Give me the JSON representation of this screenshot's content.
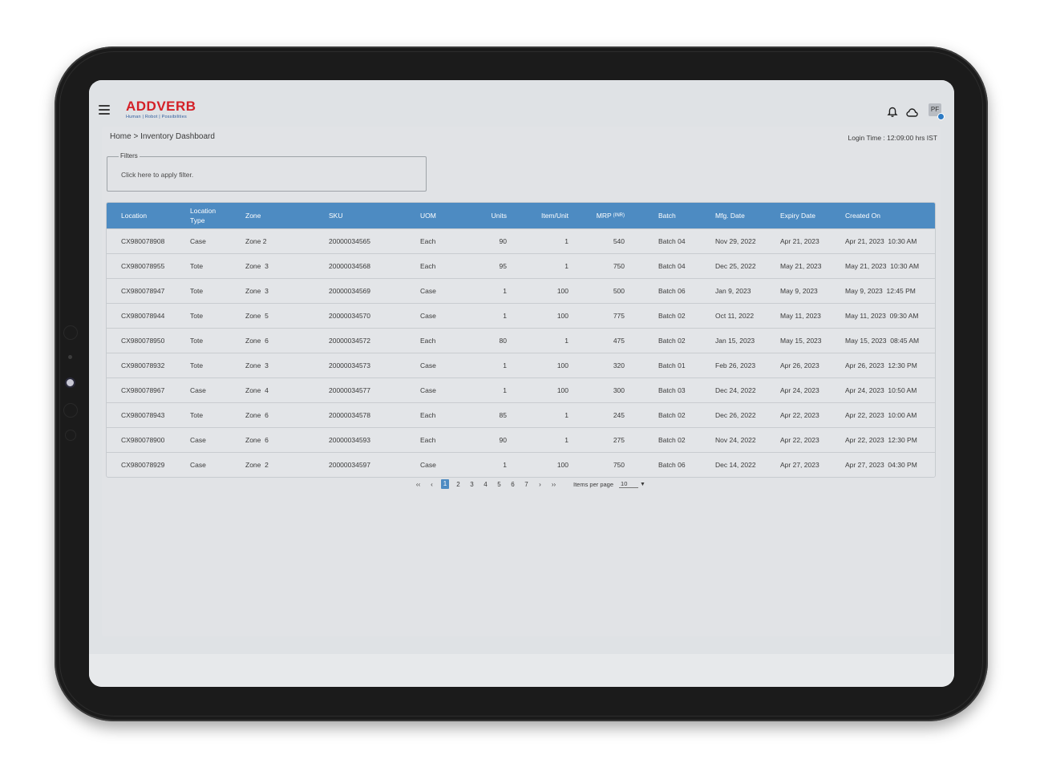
{
  "app": {
    "brand_name": "ADDVERB",
    "brand_tagline": "Human | Robot | Possibilities",
    "avatar_initials": "PF",
    "brand_color": "#d42027",
    "accent_color": "#4d8bc2"
  },
  "breadcrumb": "Home > Inventory Dashboard",
  "login_time": "Login Time : 12:09:00 hrs IST",
  "filters": {
    "legend": "Filters",
    "placeholder": "Click here to apply filter."
  },
  "table": {
    "headers": {
      "location": "Location",
      "location_type": "Location Type",
      "zone": "Zone",
      "sku": "SKU",
      "uom": "UOM",
      "units": "Units",
      "item_unit": "Item/Unit",
      "mrp": "MRP",
      "mrp_unit": "(INR)",
      "batch": "Batch",
      "mfg_date": "Mfg. Date",
      "expiry_date": "Expiry Date",
      "created_on": "Created On"
    },
    "rows": [
      [
        "CX980078908",
        "Case",
        "Zone 2",
        "20000034565",
        "Each",
        "90",
        "1",
        "540",
        "Batch 04",
        "Nov 29, 2022",
        "Apr 21, 2023",
        "Apr 21, 2023  10:30 AM"
      ],
      [
        "CX980078955",
        "Tote",
        "Zone  3",
        "20000034568",
        "Each",
        "95",
        "1",
        "750",
        "Batch 04",
        "Dec 25, 2022",
        "May 21, 2023",
        "May 21, 2023  10:30 AM"
      ],
      [
        "CX980078947",
        "Tote",
        "Zone  3",
        "20000034569",
        "Case",
        "1",
        "100",
        "500",
        "Batch 06",
        "Jan 9, 2023",
        "May 9, 2023",
        "May 9, 2023  12:45 PM"
      ],
      [
        "CX980078944",
        "Tote",
        "Zone  5",
        "20000034570",
        "Case",
        "1",
        "100",
        "775",
        "Batch 02",
        "Oct 11, 2022",
        "May 11, 2023",
        "May 11, 2023  09:30 AM"
      ],
      [
        "CX980078950",
        "Tote",
        "Zone  6",
        "20000034572",
        "Each",
        "80",
        "1",
        "475",
        "Batch 02",
        "Jan 15, 2023",
        "May 15, 2023",
        "May 15, 2023  08:45 AM"
      ],
      [
        "CX980078932",
        "Tote",
        "Zone  3",
        "20000034573",
        "Case",
        "1",
        "100",
        "320",
        "Batch 01",
        "Feb 26, 2023",
        "Apr 26, 2023",
        "Apr 26, 2023  12:30 PM"
      ],
      [
        "CX980078967",
        "Case",
        "Zone  4",
        "20000034577",
        "Case",
        "1",
        "100",
        "300",
        "Batch 03",
        "Dec 24, 2022",
        "Apr 24, 2023",
        "Apr 24, 2023  10:50 AM"
      ],
      [
        "CX980078943",
        "Tote",
        "Zone  6",
        "20000034578",
        "Each",
        "85",
        "1",
        "245",
        "Batch 02",
        "Dec 26, 2022",
        "Apr 22, 2023",
        "Apr 22, 2023  10:00 AM"
      ],
      [
        "CX980078900",
        "Case",
        "Zone  6",
        "20000034593",
        "Each",
        "90",
        "1",
        "275",
        "Batch 02",
        "Nov 24, 2022",
        "Apr 22, 2023",
        "Apr 22, 2023  12:30 PM"
      ],
      [
        "CX980078929",
        "Case",
        "Zone  2",
        "20000034597",
        "Case",
        "1",
        "100",
        "750",
        "Batch 06",
        "Dec 14, 2022",
        "Apr 27, 2023",
        "Apr 27, 2023  04:30 PM"
      ]
    ]
  },
  "pagination": {
    "first": "‹‹",
    "prev": "‹",
    "pages": [
      "1",
      "2",
      "3",
      "4",
      "5",
      "6",
      "7"
    ],
    "current_page": "1",
    "next": "›",
    "last": "››",
    "items_per_page_label": "Items per page",
    "items_per_page_value": "10"
  }
}
